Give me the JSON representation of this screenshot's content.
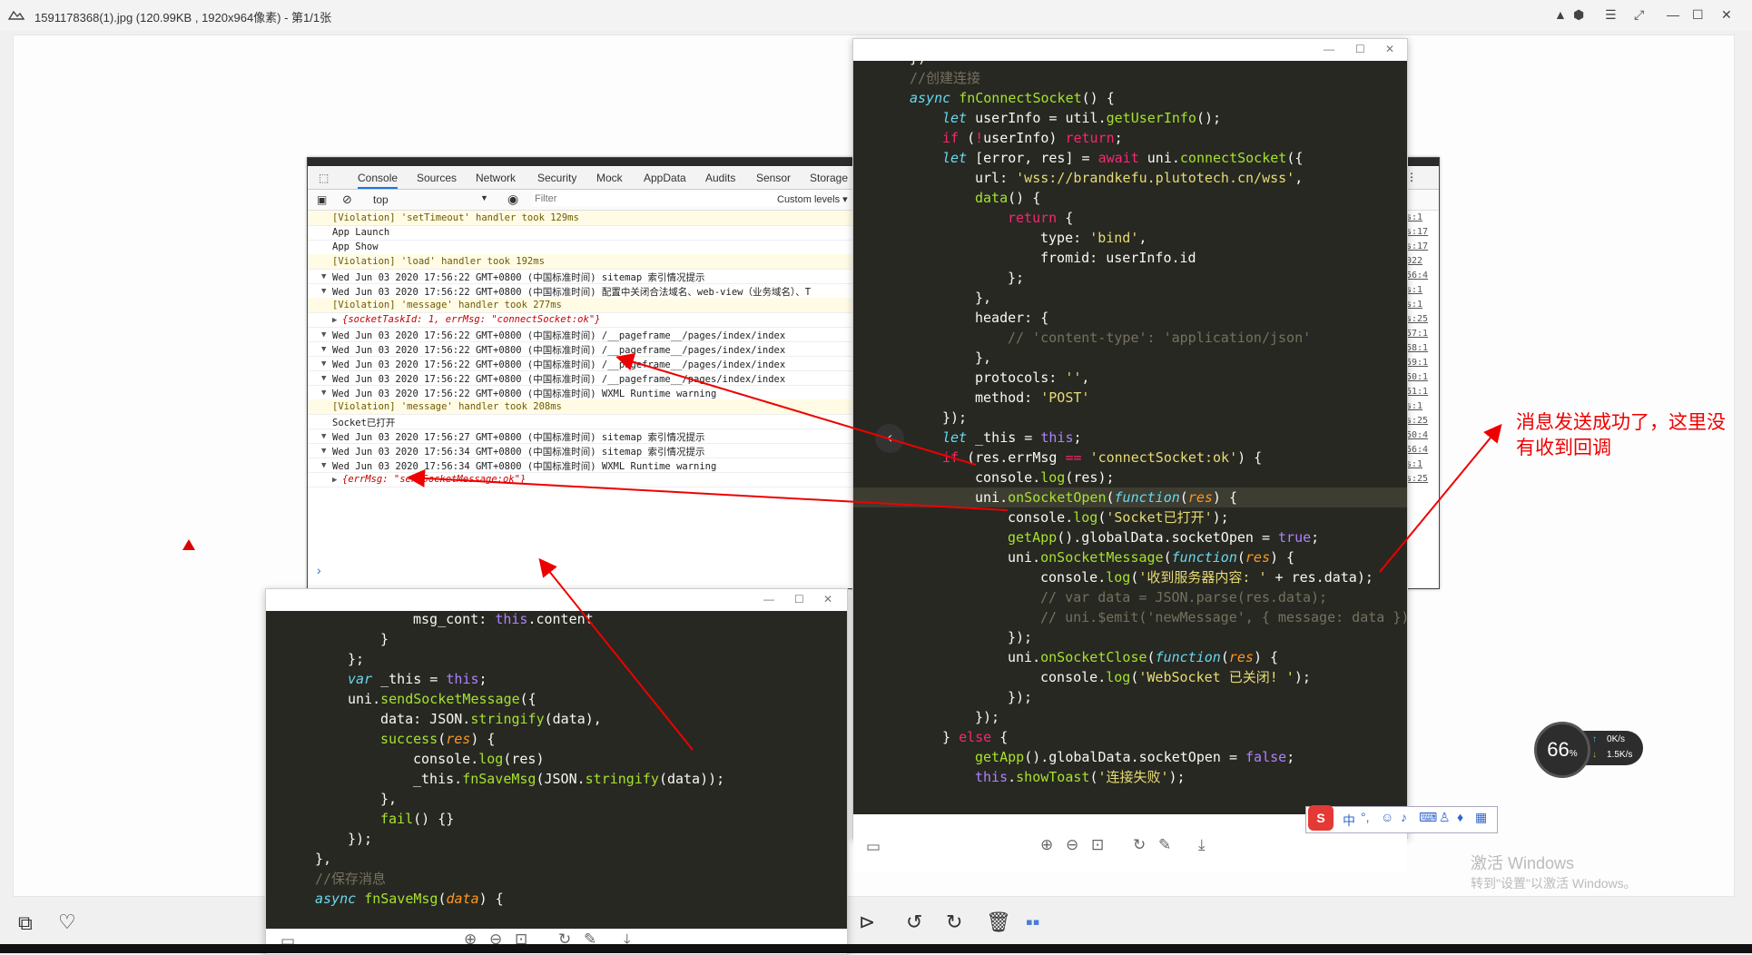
{
  "viewer": {
    "title": "1591178368(1).jpg (120.99KB , 1920x964像素) - 第1/1张"
  },
  "devtools": {
    "tabs": [
      "Console",
      "Sources",
      "Network",
      "Security",
      "Mock",
      "AppData",
      "Audits",
      "Sensor",
      "Storage"
    ],
    "context": "top",
    "filter_placeholder": "Filter",
    "levels": "Custom levels ▾",
    "log": [
      {
        "kind": "warn",
        "text": "[Violation] 'setTimeout' handler took 129ms"
      },
      {
        "kind": "plain",
        "text": "App Launch"
      },
      {
        "kind": "plain",
        "text": "App Show"
      },
      {
        "kind": "warn",
        "text": "[Violation] 'load' handler took 192ms"
      },
      {
        "kind": "group",
        "text": "Wed Jun 03 2020 17:56:22 GMT+0800 (中国标准时间) sitemap 索引情况提示"
      },
      {
        "kind": "group",
        "text": "Wed Jun 03 2020 17:56:22 GMT+0800 (中国标准时间) 配置中关闭合法域名、web-view（业务域名）、T"
      },
      {
        "kind": "warn",
        "text": "[Violation] 'message' handler took 277ms"
      },
      {
        "kind": "object",
        "text": "{socketTaskId: 1, errMsg: \"connectSocket:ok\"}"
      },
      {
        "kind": "group",
        "text": "Wed Jun 03 2020 17:56:22 GMT+0800 (中国标准时间) /__pageframe__/pages/index/index"
      },
      {
        "kind": "group",
        "text": "Wed Jun 03 2020 17:56:22 GMT+0800 (中国标准时间) /__pageframe__/pages/index/index"
      },
      {
        "kind": "group",
        "text": "Wed Jun 03 2020 17:56:22 GMT+0800 (中国标准时间) /__pageframe__/pages/index/index"
      },
      {
        "kind": "group",
        "text": "Wed Jun 03 2020 17:56:22 GMT+0800 (中国标准时间) /__pageframe__/pages/index/index"
      },
      {
        "kind": "group",
        "text": "Wed Jun 03 2020 17:56:22 GMT+0800 (中国标准时间) WXML Runtime warning"
      },
      {
        "kind": "warn",
        "text": "[Violation] 'message' handler took 208ms"
      },
      {
        "kind": "plain",
        "text": "Socket已打开"
      },
      {
        "kind": "group",
        "text": "Wed Jun 03 2020 17:56:27 GMT+0800 (中国标准时间) sitemap 索引情况提示"
      },
      {
        "kind": "group",
        "text": "Wed Jun 03 2020 17:56:34 GMT+0800 (中国标准时间) sitemap 索引情况提示"
      },
      {
        "kind": "group",
        "text": "Wed Jun 03 2020 17:56:34 GMT+0800 (中国标准时间) WXML Runtime warning"
      },
      {
        "kind": "object",
        "text": "{errMsg: \"sendSocketMessage:ok\"}"
      }
    ],
    "prompt": "›",
    "side_links": [
      "s:1",
      "s:17",
      "s:17",
      "022",
      "56:4",
      "s:1",
      "s:1",
      "s:25",
      "57:1",
      "58:1",
      "59:1",
      "50:1",
      "51:1",
      "s:1",
      "s:25",
      "50:4",
      "56:4",
      "s:1",
      "s:25"
    ]
  },
  "annotation": "消息发送成功了，这里没有收到回调",
  "network": {
    "percent": "66",
    "percent_unit": "%",
    "up": "0",
    "up_unit": "K/s",
    "down": "1.5",
    "down_unit": "K/s"
  },
  "watermark": {
    "line1": "激活 Windows",
    "line2": "转到\"设置\"以激活 Windows。"
  },
  "ime": {
    "label": "中"
  }
}
